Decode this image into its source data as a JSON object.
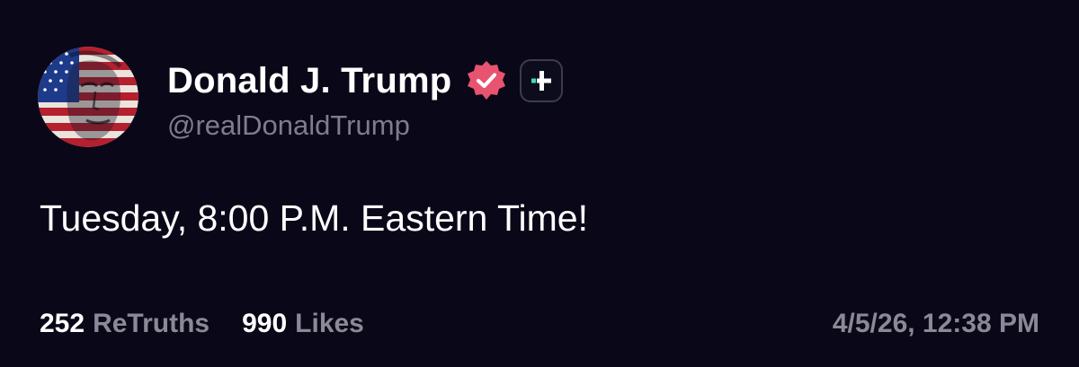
{
  "post": {
    "author": {
      "display_name": "Donald J. Trump",
      "handle": "@realDonaldTrump",
      "avatar": "flag-portrait-avatar",
      "verified_icon": "verified-check-icon",
      "plus_icon": "truth-plus-icon"
    },
    "text": "Tuesday, 8:00 P.M. Eastern Time!",
    "stats": {
      "retruths_count": "252",
      "retruths_label": "ReTruths",
      "likes_count": "990",
      "likes_label": "Likes"
    },
    "timestamp": "4/5/26, 12:38 PM"
  },
  "colors": {
    "background": "#0a0818",
    "verified_badge": "#e8536f",
    "plus_accent": "#3fe0b5",
    "muted_text": "#8a8996"
  }
}
